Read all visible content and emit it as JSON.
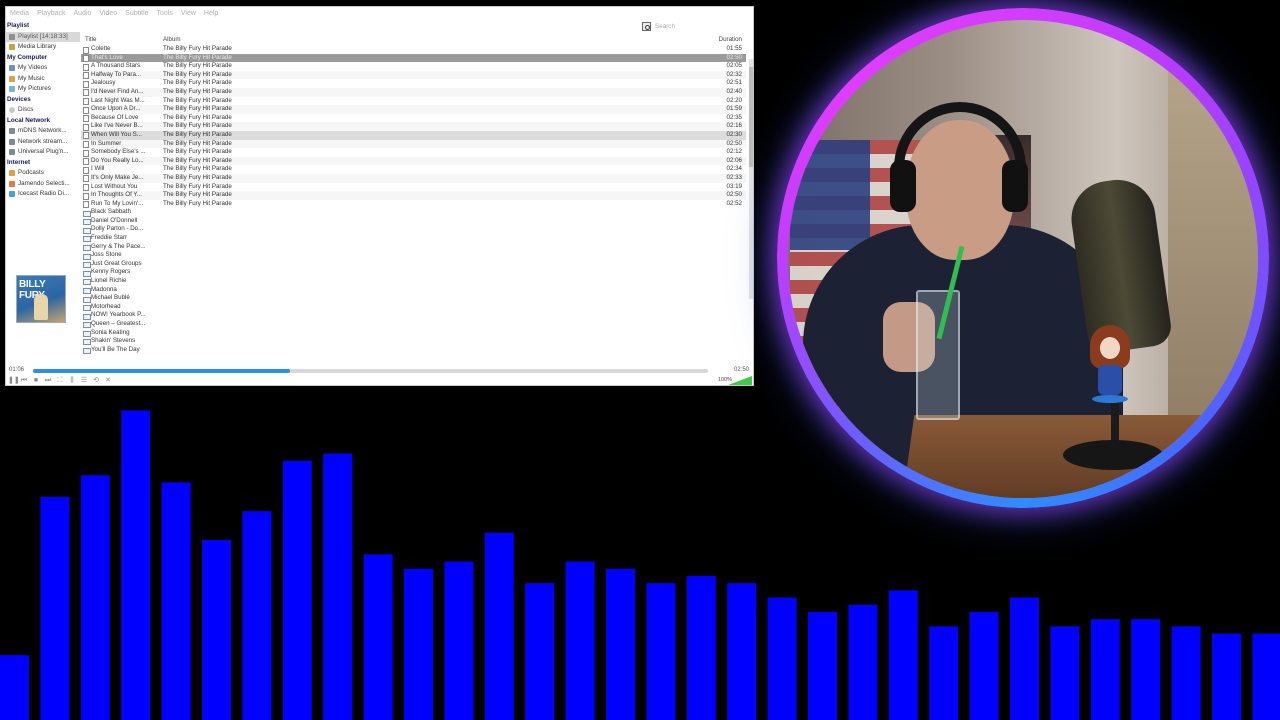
{
  "menu": [
    "Media",
    "Playback",
    "Audio",
    "Video",
    "Subtitle",
    "Tools",
    "View",
    "Help"
  ],
  "sidebar": {
    "playlist_heading": "Playlist",
    "playlist_item": "Playlist [14:18:33]",
    "media_library": "Media Library",
    "my_computer_heading": "My Computer",
    "my_computer_items": [
      "My Videos",
      "My Music",
      "My Pictures"
    ],
    "devices_heading": "Devices",
    "devices_items": [
      "Discs"
    ],
    "local_network_heading": "Local Network",
    "local_network_items": [
      "mDNS Network...",
      "Network stream...",
      "Universal Plug'n..."
    ],
    "internet_heading": "Internet",
    "internet_items": [
      "Podcasts",
      "Jamendo Selecti...",
      "Icecast Radio Di..."
    ]
  },
  "album_art": {
    "title": "BILLY FURY"
  },
  "search": {
    "placeholder": "Search"
  },
  "playlist": {
    "headers": {
      "title": "Title",
      "album": "Album",
      "duration": "Duration"
    },
    "rows": [
      {
        "title": "Colette",
        "album": "The Billy Fury Hit Parade",
        "duration": "01:55",
        "state": "normal"
      },
      {
        "title": "That's Love",
        "album": "The Billy Fury Hit Parade",
        "duration": "02:50",
        "state": "current"
      },
      {
        "title": "A Thousand Stars",
        "album": "The Billy Fury Hit Parade",
        "duration": "02:05",
        "state": "normal"
      },
      {
        "title": "Halfway To Para...",
        "album": "The Billy Fury Hit Parade",
        "duration": "02:32",
        "state": "normal"
      },
      {
        "title": "Jealousy",
        "album": "The Billy Fury Hit Parade",
        "duration": "02:51",
        "state": "normal"
      },
      {
        "title": "I'd Never Find An...",
        "album": "The Billy Fury Hit Parade",
        "duration": "02:40",
        "state": "normal"
      },
      {
        "title": "Last Night Was M...",
        "album": "The Billy Fury Hit Parade",
        "duration": "02:20",
        "state": "normal"
      },
      {
        "title": "Once Upon A Dr...",
        "album": "The Billy Fury Hit Parade",
        "duration": "01:59",
        "state": "normal"
      },
      {
        "title": "Because Of Love",
        "album": "The Billy Fury Hit Parade",
        "duration": "02:35",
        "state": "normal"
      },
      {
        "title": "Like I've Never B...",
        "album": "The Billy Fury Hit Parade",
        "duration": "02:16",
        "state": "normal"
      },
      {
        "title": "When Will You S...",
        "album": "The Billy Fury Hit Parade",
        "duration": "02:30",
        "state": "hl"
      },
      {
        "title": "In Summer",
        "album": "The Billy Fury Hit Parade",
        "duration": "02:50",
        "state": "normal"
      },
      {
        "title": "Somebody Else's ...",
        "album": "The Billy Fury Hit Parade",
        "duration": "02:12",
        "state": "normal"
      },
      {
        "title": "Do You Really Lo...",
        "album": "The Billy Fury Hit Parade",
        "duration": "02:06",
        "state": "normal"
      },
      {
        "title": "I Will",
        "album": "The Billy Fury Hit Parade",
        "duration": "02:34",
        "state": "normal"
      },
      {
        "title": "It's Only Make Je...",
        "album": "The Billy Fury Hit Parade",
        "duration": "02:33",
        "state": "normal"
      },
      {
        "title": "Lost Without You",
        "album": "The Billy Fury Hit Parade",
        "duration": "03:19",
        "state": "normal"
      },
      {
        "title": "In Thoughts Of Y...",
        "album": "The Billy Fury Hit Parade",
        "duration": "02:50",
        "state": "normal"
      },
      {
        "title": "Run To My Lovin'...",
        "album": "The Billy Fury Hit Parade",
        "duration": "02:52",
        "state": "normal"
      }
    ],
    "folders": [
      "Black Sabbath",
      "Daniel O'Donnell",
      "Dolly Parton - Do...",
      "Freddie Starr",
      "Gerry & The Pace...",
      "Joss Stone",
      "Just Great Groups",
      "Kenny Rogers",
      "Lionel Richie",
      "Madonna",
      "Michael Bublé",
      "Motorhead",
      "NOW! Yearbook P...",
      "Queen – Greatest...",
      "Sonia Keating",
      "Shakin' Stevens",
      "You'll Be The Day"
    ]
  },
  "seek": {
    "elapsed": "01:06",
    "total": "02:50",
    "progress": 0.38
  },
  "controls": [
    "pause-icon",
    "previous-icon",
    "stop-icon",
    "next-icon",
    "fullscreen-icon",
    "extended-settings-icon",
    "playlist-icon",
    "loop-icon",
    "shuffle-icon"
  ],
  "controls_glyphs": [
    "❚❚",
    "⏮",
    "■",
    "⏭",
    "⛶",
    "⫼",
    "☰",
    "⟲",
    "✕"
  ],
  "volume": {
    "percent": "100%",
    "level": 1.0,
    "color": "#42c84a"
  },
  "theme": {
    "accent": "#2d8ee6",
    "ring_primary": "#c03cff",
    "ring_secondary": "#2f8cff",
    "visualizer": "#0000ff"
  },
  "visualizer": {
    "bars": [
      0.09,
      0.31,
      0.34,
      0.43,
      0.33,
      0.25,
      0.29,
      0.36,
      0.37,
      0.23,
      0.21,
      0.22,
      0.26,
      0.19,
      0.22,
      0.21,
      0.19,
      0.2,
      0.19,
      0.17,
      0.15,
      0.16,
      0.18,
      0.13,
      0.15,
      0.17,
      0.13,
      0.14,
      0.14,
      0.13,
      0.12,
      0.12
    ]
  }
}
